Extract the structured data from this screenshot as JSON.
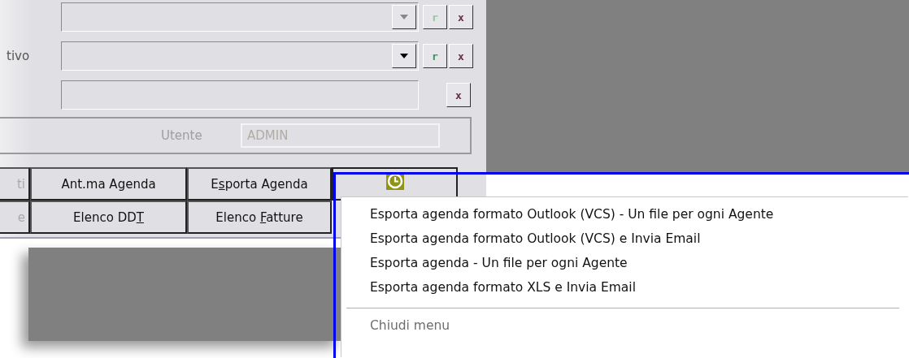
{
  "form": {
    "rows": [
      {
        "kind": "combo",
        "disabled": true,
        "r_button": "r",
        "clear_button": "x"
      },
      {
        "kind": "combo",
        "label": "tivo",
        "disabled": false,
        "r_button": "r",
        "clear_button": "x"
      },
      {
        "kind": "text",
        "clear_button": "x"
      }
    ],
    "user": {
      "label": "Utente",
      "value": "ADMIN",
      "disabled": true
    }
  },
  "buttons": [
    [
      {
        "kind": "cut",
        "label": "ti"
      },
      {
        "kind": "text",
        "label": "Ant.ma Agenda"
      },
      {
        "kind": "text",
        "before": "E",
        "key": "s",
        "after": "porta Agenda"
      },
      {
        "kind": "icon",
        "pressed": true
      }
    ],
    [
      {
        "kind": "cut",
        "label": "e"
      },
      {
        "kind": "text",
        "before": "Elenco DD",
        "key": "T"
      },
      {
        "kind": "text",
        "before": "Elenco ",
        "key": "F",
        "after": "atture"
      }
    ]
  ],
  "menu": {
    "items": [
      {
        "kind": "item",
        "label": "Esporta agenda formato Outlook (VCS) - Un file per ogni Agente",
        "disabled": false
      },
      {
        "kind": "item",
        "label": "Esporta agenda formato Outlook (VCS) e Invia Email",
        "disabled": false
      },
      {
        "kind": "item",
        "label": "Esporta agenda - Un file per ogni Agente",
        "disabled": false
      },
      {
        "kind": "item",
        "label": "Esporta agenda formato XLS e Invia Email",
        "disabled": false
      },
      {
        "kind": "separator"
      },
      {
        "kind": "item",
        "label": "Chiudi menu",
        "disabled": true
      }
    ]
  }
}
